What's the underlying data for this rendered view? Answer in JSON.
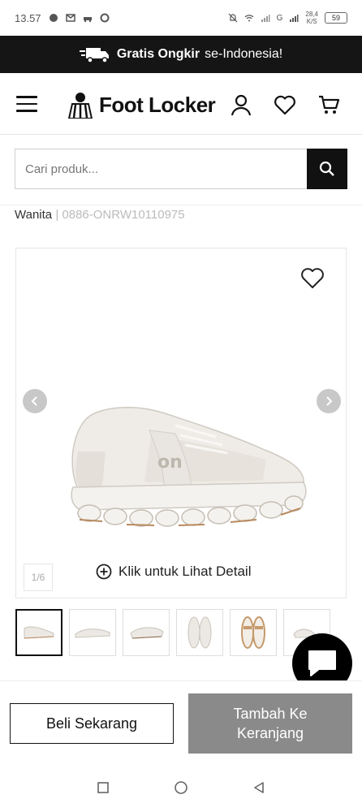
{
  "status_bar": {
    "time": "13.57",
    "network_speed": "28,4",
    "network_unit": "K/S",
    "signal_label": "G",
    "battery": "59"
  },
  "promo": {
    "bold_text": "Gratis Ongkir",
    "rest_text": "se-Indonesia!"
  },
  "header": {
    "brand": "Foot Locker"
  },
  "search": {
    "placeholder": "Cari produk..."
  },
  "product": {
    "category": "Wanita",
    "separator": "|",
    "sku": "0886-ONRW10110975"
  },
  "gallery": {
    "counter": "1/6",
    "detail_label": "Klik untuk Lihat Detail",
    "thumbnail_count": 6,
    "active_index": 0
  },
  "actions": {
    "buy_now": "Beli Sekarang",
    "add_to_cart": "Tambah Ke Keranjang"
  },
  "colors": {
    "promo_bg": "#151515",
    "add_cart_bg": "#8a8a8a",
    "search_button_bg": "#111111"
  }
}
